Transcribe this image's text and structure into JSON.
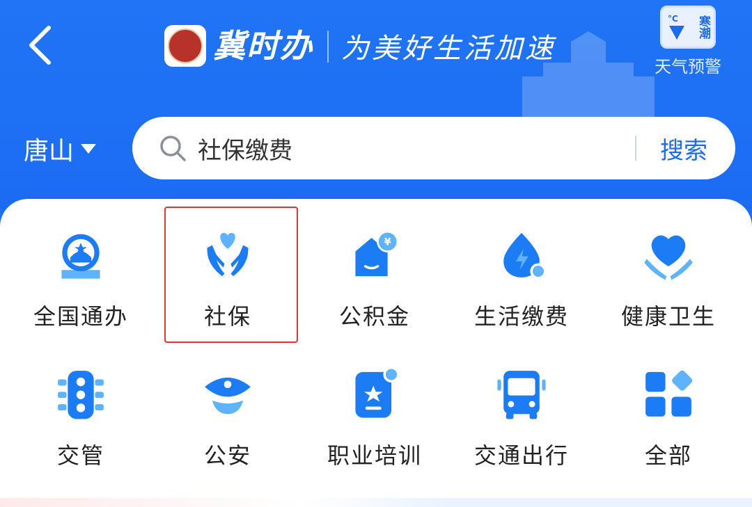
{
  "header": {
    "app_name": "冀时办",
    "slogan": "为美好生活加速",
    "weather_alert": {
      "badge_top": "寒",
      "badge_bottom": "潮",
      "badge_unit": "°C",
      "label": "天气预警"
    }
  },
  "location": {
    "city": "唐山"
  },
  "search": {
    "value": "社保缴费",
    "button_label": "搜索"
  },
  "services": [
    {
      "label": "全国通办",
      "icon": "globe-icon"
    },
    {
      "label": "社保",
      "icon": "heart-hands-icon"
    },
    {
      "label": "公积金",
      "icon": "house-fund-icon"
    },
    {
      "label": "生活缴费",
      "icon": "water-drop-bolt-icon"
    },
    {
      "label": "健康卫生",
      "icon": "heart-care-icon"
    },
    {
      "label": "交管",
      "icon": "traffic-light-icon"
    },
    {
      "label": "公安",
      "icon": "police-cap-icon"
    },
    {
      "label": "职业培训",
      "icon": "certificate-icon"
    },
    {
      "label": "交通出行",
      "icon": "bus-icon"
    },
    {
      "label": "全部",
      "icon": "grid-all-icon"
    }
  ],
  "colors": {
    "brand": "#1c6cf3",
    "icon_primary": "#1c7cf6",
    "icon_light": "#5fb3fb",
    "highlight": "#e8302f"
  }
}
